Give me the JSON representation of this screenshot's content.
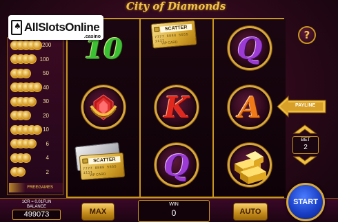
{
  "watermark": {
    "brand": "AllSlotsOnline",
    "suffix": ".casino"
  },
  "title": "City of Diamonds",
  "paytable": {
    "rows": [
      {
        "coins": 5,
        "value": "200"
      },
      {
        "coins": 4,
        "value": "100"
      },
      {
        "coins": 3,
        "value": "50"
      },
      {
        "coins": 5,
        "value": "40"
      },
      {
        "coins": 4,
        "value": "30"
      },
      {
        "coins": 3,
        "value": "20"
      },
      {
        "coins": 5,
        "value": "10"
      },
      {
        "coins": 4,
        "value": "6"
      },
      {
        "coins": 3,
        "value": "4"
      },
      {
        "coins": 2,
        "value": "2"
      }
    ],
    "freegames_label": "FREEGAMES"
  },
  "reels": [
    [
      "10",
      "ring",
      "scatter"
    ],
    [
      "scatter",
      "K",
      "Q"
    ],
    [
      "Q",
      "A",
      "gold-bars"
    ]
  ],
  "scatter": {
    "label": "SCATTER",
    "number": "7777 8888 5555 1111",
    "vip": "VIP CARD"
  },
  "letters": {
    "ten": "10",
    "k": "K",
    "q": "Q",
    "a": "A"
  },
  "controls": {
    "help": "?",
    "payline": "PAYLINE",
    "bet_label": "BET",
    "bet_value": "2",
    "credit_info": "1CR = 0.01FUN",
    "balance_label": "BALANCE",
    "balance_value": "499073",
    "max_label": "MAX",
    "win_label": "WIN",
    "win_value": "0",
    "auto_label": "AUTO",
    "start_label": "START"
  },
  "colors": {
    "gold": "#c9961e",
    "background": "#2a0818",
    "start_button": "#1a40c8"
  }
}
